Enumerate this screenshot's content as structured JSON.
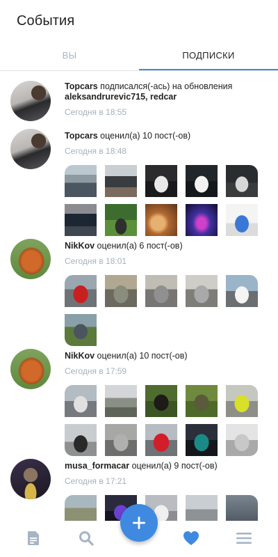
{
  "header": {
    "title": "События"
  },
  "tabs": [
    {
      "label": "ВЫ",
      "active": false
    },
    {
      "label": "ПОДПИСКИ",
      "active": true
    }
  ],
  "events": [
    {
      "user": "Topcars",
      "action": " подписался(-ась) на обновления",
      "targets": "aleksandrurevic715, redcar",
      "time": "Сегодня в 18:55",
      "avatar_icon": "car-avatar",
      "thumbs": []
    },
    {
      "user": "Topcars",
      "action": " оценил(а) 10 пост(-ов)",
      "targets": "",
      "time": "Сегодня в 18:48",
      "avatar_icon": "car-avatar",
      "thumbs": [
        "car-photo",
        "car-photo",
        "car-photo",
        "car-photo",
        "car-photo",
        "car-photo",
        "car-photo",
        "car-photo",
        "car-photo",
        "car-photo"
      ]
    },
    {
      "user": "NikKov",
      "action": " оценил(а) 6 пост(-ов)",
      "targets": "",
      "time": "Сегодня в 18:01",
      "avatar_icon": "elephant-avatar",
      "thumbs": [
        "car-photo",
        "car-photo",
        "car-photo",
        "car-photo",
        "car-photo",
        "car-photo"
      ]
    },
    {
      "user": "NikKov",
      "action": " оценил(а) 10 пост(-ов)",
      "targets": "",
      "time": "Сегодня в 17:59",
      "avatar_icon": "elephant-avatar",
      "thumbs": [
        "car-photo",
        "car-photo",
        "car-photo",
        "car-photo",
        "car-photo",
        "car-photo",
        "car-photo",
        "car-photo",
        "car-photo",
        "car-photo"
      ]
    },
    {
      "user": "musa_formacar",
      "action": " оценил(а) 9 пост(-ов)",
      "targets": "",
      "time": "Сегодня в 17:21",
      "avatar_icon": "person-avatar",
      "thumbs": [
        "car-photo",
        "car-photo",
        "car-photo",
        "car-photo",
        "car-photo"
      ]
    }
  ],
  "bottom_nav": {
    "items": [
      {
        "icon": "news-icon",
        "active": false
      },
      {
        "icon": "search-icon",
        "active": false
      },
      {
        "icon": "plus-icon",
        "active": false
      },
      {
        "icon": "heart-icon",
        "active": true
      },
      {
        "icon": "menu-icon",
        "active": false
      }
    ]
  },
  "colors": {
    "accent": "#3f8ae0",
    "inactive_icon": "#a6b4c4",
    "secondary_text": "#a6b0bb"
  }
}
